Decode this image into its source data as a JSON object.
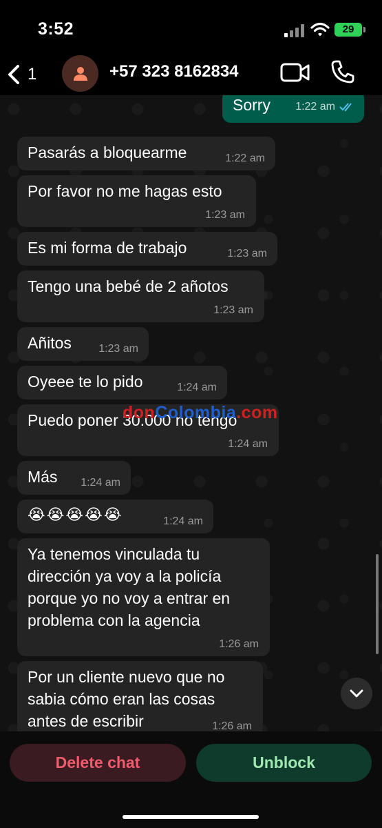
{
  "status_bar": {
    "time": "3:52",
    "battery": "29"
  },
  "header": {
    "back_count": "1",
    "contact": "+57 323 8162834"
  },
  "messages": [
    {
      "text": "Sorry",
      "time": "1:22 am"
    },
    {
      "text": "Pasarás a bloquearme",
      "time": "1:22 am"
    },
    {
      "text": "Por favor no me hagas esto",
      "time": "1:23 am"
    },
    {
      "text": "Es mi forma de trabajo",
      "time": "1:23 am"
    },
    {
      "text": "Tengo una bebé de 2 añotos",
      "time": "1:23 am"
    },
    {
      "text": "Añitos",
      "time": "1:23 am"
    },
    {
      "text": "Oyeee te lo pido",
      "time": "1:24 am"
    },
    {
      "text": "Puedo poner 30.000 no tengo",
      "time": "1:24 am"
    },
    {
      "text": "Más",
      "time": "1:24 am"
    },
    {
      "text": "😭😭😭😭😭",
      "time": "1:24 am"
    },
    {
      "lines": [
        "Ya tenemos vinculada tu",
        "dirección ya voy a la policía",
        "porque yo no voy a entrar en",
        "problema con la agencia"
      ],
      "time": "1:26 am"
    },
    {
      "lines": [
        "Por un cliente nuevo que no",
        "sabia cómo eran las cosas",
        "antes de escribir"
      ],
      "time": "1:26 am"
    }
  ],
  "watermark": {
    "part1": "don",
    "part2": "Colombia",
    "part3": ".com"
  },
  "footer": {
    "delete_label": "Delete chat",
    "unblock_label": "Unblock"
  },
  "colors": {
    "outgoing": "#005c4b",
    "incoming": "#242424",
    "delete": "#f15c6d",
    "unblock": "#9fe8b0",
    "read_ticks": "#53bdeb"
  }
}
